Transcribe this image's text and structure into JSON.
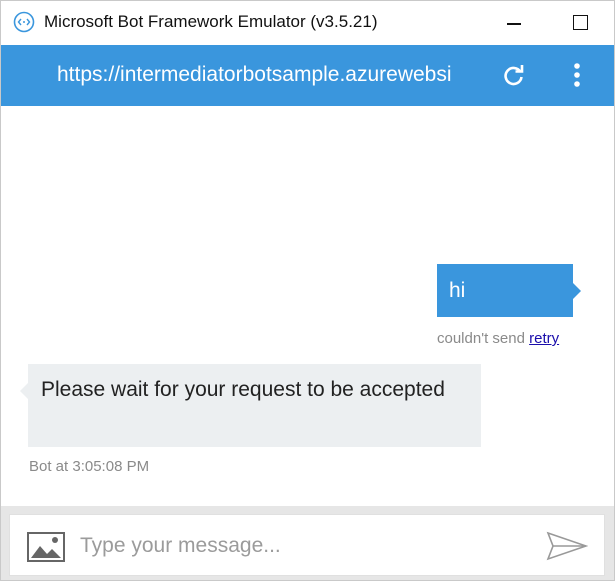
{
  "window": {
    "title": "Microsoft Bot Framework Emulator (v3.5.21)"
  },
  "header": {
    "url": "https://intermediatorbotsample.azurewebsi"
  },
  "messages": {
    "user": {
      "text": "hi",
      "status": "couldn't send",
      "retry_label": "retry"
    },
    "bot": {
      "text": "Please wait for your request to be accepted",
      "meta": "Bot at 3:05:08 PM"
    }
  },
  "composer": {
    "placeholder": "Type your message..."
  },
  "colors": {
    "accent": "#3a96dd",
    "bot_bubble": "#eceff1",
    "composer_bg": "#e6e6e6"
  },
  "icons": [
    "app-icon",
    "minimize-icon",
    "maximize-icon",
    "refresh-icon",
    "more-vert-icon",
    "image-icon",
    "send-icon"
  ]
}
